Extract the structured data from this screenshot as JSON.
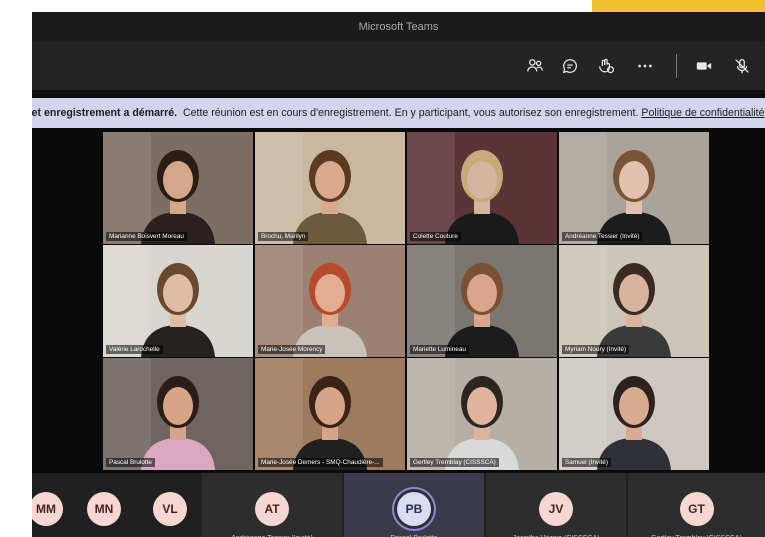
{
  "window": {
    "title": "Microsoft Teams"
  },
  "toolbar": {
    "buttons": [
      {
        "name": "people-button",
        "icon": "people-icon"
      },
      {
        "name": "chat-button",
        "icon": "chat-icon"
      },
      {
        "name": "reactions-button",
        "icon": "reactions-icon"
      },
      {
        "name": "more-button",
        "icon": "more-icon"
      },
      {
        "name": "camera-button",
        "icon": "camera-icon"
      },
      {
        "name": "mic-button",
        "icon": "mic-off-icon"
      }
    ]
  },
  "banner": {
    "bold_text": "Cet enregistrement a démarré.",
    "text": "Cette réunion est en cours d'enregistrement. En y participant, vous autorisez son enregistrement.",
    "link": "Politique de confidentialité"
  },
  "participants": [
    {
      "name": "Marianne Boisvert Moreau",
      "bg": "#7d6e63",
      "shirt": "#2a2020",
      "skin": "#d4a68c",
      "hair": "#2a1d16"
    },
    {
      "name": "Brochu, Marilyn",
      "bg": "#c9b79f",
      "shirt": "#6b5a3e",
      "skin": "#d9a98c",
      "hair": "#5a3b22"
    },
    {
      "name": "Colette Couture",
      "bg": "#5b3438",
      "shirt": "#1a1a1a",
      "skin": "#d7b4a0",
      "hair": "#c9a97a"
    },
    {
      "name": "Andréanne Tessier (Invité)",
      "bg": "#a9a39a",
      "shirt": "#1d1d1d",
      "skin": "#e2c0ae",
      "hair": "#7a5436"
    },
    {
      "name": "Valérie Larochelle",
      "bg": "#d8d6d1",
      "shirt": "#26221f",
      "skin": "#e0bba6",
      "hair": "#6a4a2f"
    },
    {
      "name": "Marie-Josée Morency",
      "bg": "#9c8172",
      "shirt": "#c9c2bb",
      "skin": "#e1ad93",
      "hair": "#b64a2c"
    },
    {
      "name": "Mariette Lumineau",
      "bg": "#7a7670",
      "shirt": "#1c1c1c",
      "skin": "#d9a58c",
      "hair": "#7b5134"
    },
    {
      "name": "Myriam Noury (Invité)",
      "bg": "#ccc6b8",
      "shirt": "#3a3a3a",
      "skin": "#d8b29c",
      "hair": "#3a2a20"
    },
    {
      "name": "Pascal Brulotte",
      "bg": "#6f6560",
      "shirt": "#d8a9c0",
      "skin": "#d8a488",
      "hair": "#2a1f18"
    },
    {
      "name": "Marie-Josée Demers - SMQ-Chaudière-...",
      "bg": "#9e7a5e",
      "shirt": "#202020",
      "skin": "#d8a488",
      "hair": "#3a2418"
    },
    {
      "name": "Gertley Tremblay (CISSSCA)",
      "bg": "#b5afa6",
      "shirt": "#d9d9d9",
      "skin": "#e0b49c",
      "hair": "#2a2622"
    },
    {
      "name": "Samuel (Invité)",
      "bg": "#cdc9c2",
      "shirt": "#2f3136",
      "skin": "#d9ab92",
      "hair": "#2d231c"
    }
  ],
  "tray": [
    {
      "initials": "MM",
      "label": ""
    },
    {
      "initials": "MN",
      "label": ""
    },
    {
      "initials": "VL",
      "label": ""
    },
    {
      "initials": "AT",
      "label": "Andréanne Tessier (Invité)"
    },
    {
      "initials": "PB",
      "label": "Pascal Brulotte"
    },
    {
      "initials": "JV",
      "label": "Jacinthe Vézina (CISSSCA)"
    },
    {
      "initials": "GT",
      "label": "Gertley Tremblay (CISSSCA)"
    }
  ],
  "colors": {
    "banner_bg": "#d3d4ee",
    "accent": "#f0c030",
    "avatar_ring": "#8b8cc7"
  }
}
